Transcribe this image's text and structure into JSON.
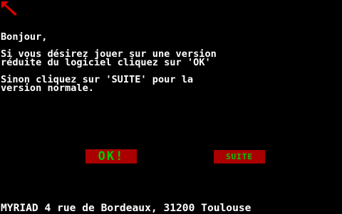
{
  "colors": {
    "background": "#000000",
    "text": "#ffffff",
    "button_bg": "#aa0000",
    "button_text": "#00cc00",
    "cursor": "#dd0000"
  },
  "cursor": {
    "icon": "arrow-pointer-icon"
  },
  "message": {
    "greeting": "Bonjour,",
    "line1": "Si vous désirez jouer sur une version",
    "line2": "réduite du logiciel cliquez sur 'OK'",
    "line3": "Sinon cliquez sur 'SUITE' pour la",
    "line4": "version normale."
  },
  "buttons": {
    "ok_label": "OK!",
    "suite_label": "SUITE"
  },
  "footer": {
    "address": "MYRIAD 4 rue de Bordeaux, 31200 Toulouse"
  }
}
